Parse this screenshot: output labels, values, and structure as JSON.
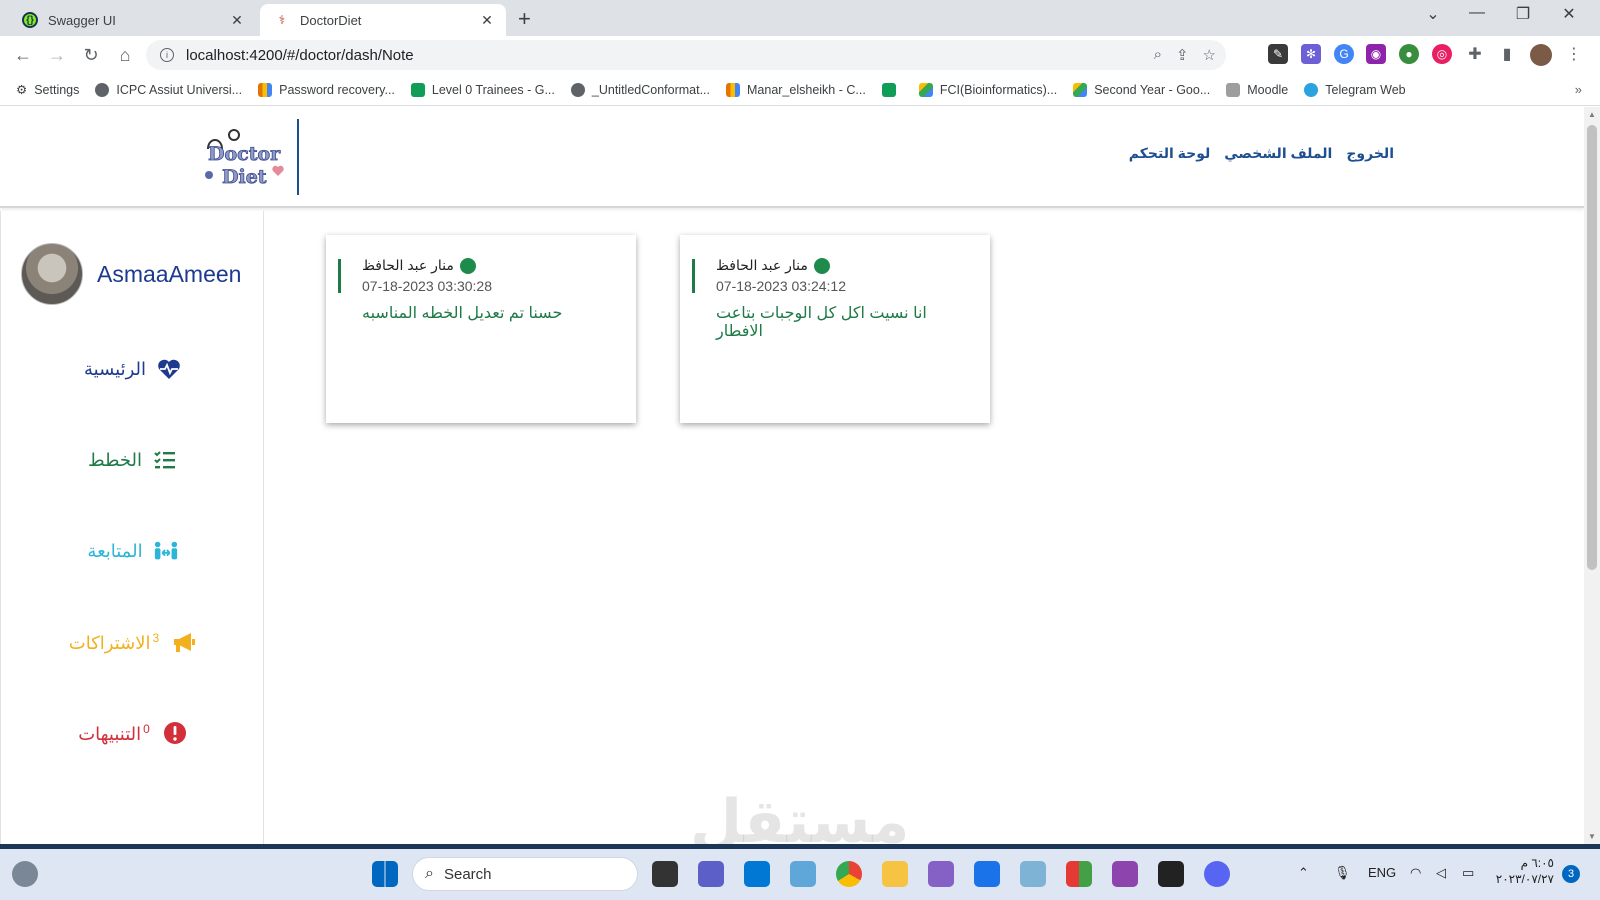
{
  "browser": {
    "tabs": [
      {
        "title": "Swagger UI",
        "active": false
      },
      {
        "title": "DoctorDiet",
        "active": true
      }
    ],
    "url": "localhost:4200/#/doctor/dash/Note",
    "bookmarks": [
      "Settings",
      "ICPC Assiut Universi...",
      "Password recovery...",
      "Level 0 Trainees - G...",
      "_UntitledConformat...",
      "Manar_elsheikh - C...",
      "",
      "FCI(Bioinformatics)...",
      "Second Year - Goo...",
      "Moodle",
      "Telegram Web"
    ]
  },
  "header": {
    "logo_line1": "Doctor",
    "logo_line2": "Diet",
    "nav": [
      "الخروج",
      "الملف الشخصي",
      "لوحة التحكم"
    ]
  },
  "sidebar": {
    "username": "AsmaaAmeen",
    "items": [
      {
        "label": "الرئيسية",
        "color": "#1d3a8f",
        "count": null
      },
      {
        "label": "الخطط",
        "color": "#1e7a46",
        "count": null
      },
      {
        "label": "المتابعة",
        "color": "#2bb5d6",
        "count": null
      },
      {
        "label": "الاشتراكات",
        "color": "#f2b01e",
        "count": "3"
      },
      {
        "label": "التنبيهات",
        "color": "#d32f3a",
        "count": "0"
      }
    ]
  },
  "notes": [
    {
      "author": "منار عبد الحافظ",
      "date": "07-18-2023 03:30:28",
      "message": "حسنا تم تعديل الخطه المناسبه"
    },
    {
      "author": "منار عبد الحافظ",
      "date": "07-18-2023 03:24:12",
      "message": "انا نسيت اكل كل الوجبات بتاعت الافطار"
    }
  ],
  "watermark": "مستقل",
  "taskbar": {
    "search_placeholder": "Search",
    "lang": "ENG",
    "time": "٦:٠٥ م",
    "date": "٢٠٢٣/٠٧/٢٧",
    "notifications": "3"
  }
}
